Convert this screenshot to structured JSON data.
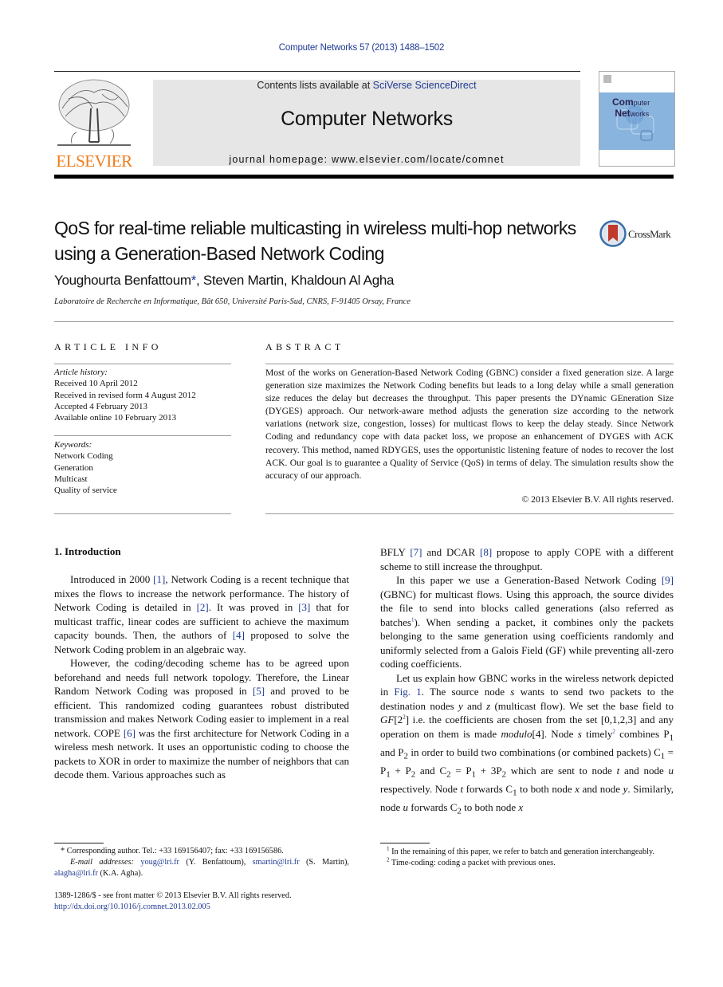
{
  "citation": "Computer Networks 57 (2013) 1488–1502",
  "header": {
    "contents_prefix": "Contents lists available at ",
    "contents_link": "SciVerse ScienceDirect",
    "journal_title": "Computer Networks",
    "homepage": "journal homepage: www.elsevier.com/locate/comnet",
    "publisher_logo_text": "ELSEVIER",
    "cover_title_line1_big": "Com",
    "cover_title_line1_small": "puter",
    "cover_title_line2_big": "Net",
    "cover_title_line2_small": "works",
    "brand_color": "#f07b1b",
    "link_color": "#1f3a93",
    "cover_color": "#88b4de"
  },
  "article": {
    "title": "QoS for real-time reliable multicasting in wireless multi-hop networks using a Generation-Based Network Coding",
    "crossmark_label": "CrossMark",
    "authors": "Youghourta Benfattoum",
    "authors_star": "*",
    "authors_rest": ", Steven Martin, Khaldoun Al Agha",
    "affiliation": "Laboratoire de Recherche en Informatique, Bât 650, Université Paris-Sud, CNRS, F-91405 Orsay, France"
  },
  "article_info": {
    "heading": "ARTICLE INFO",
    "history_label": "Article history:",
    "history": [
      "Received 10 April 2012",
      "Received in revised form 4 August 2012",
      "Accepted 4 February 2013",
      "Available online 10 February 2013"
    ],
    "keywords_label": "Keywords:",
    "keywords": [
      "Network Coding",
      "Generation",
      "Multicast",
      "Quality of service"
    ]
  },
  "abstract": {
    "heading": "ABSTRACT",
    "text": "Most of the works on Generation-Based Network Coding (GBNC) consider a fixed generation size. A large generation size maximizes the Network Coding benefits but leads to a long delay while a small generation size reduces the delay but decreases the throughput. This paper presents the DYnamic GEneration Size (DYGES) approach. Our network-aware method adjusts the generation size according to the network variations (network size, congestion, losses) for multicast flows to keep the delay steady. Since Network Coding and redundancy cope with data packet loss, we propose an enhancement of DYGES with ACK recovery. This method, named RDYGES, uses the opportunistic listening feature of nodes to recover the lost ACK. Our goal is to guarantee a Quality of Service (QoS) in terms of delay. The simulation results show the accuracy of our approach.",
    "copyright": "© 2013 Elsevier B.V. All rights reserved."
  },
  "body": {
    "section_heading": "1. Introduction",
    "left": {
      "p1": [
        "Introduced in 2000 ",
        "[1]",
        ", Network Coding is a recent technique that mixes the flows to increase the network performance. The history of Network Coding is detailed in ",
        "[2]",
        ". It was proved in ",
        "[3]",
        " that for multicast traffic, linear codes are sufficient to achieve the maximum capacity bounds. Then, the authors of ",
        "[4]",
        " proposed to solve the Network Coding problem in an algebraic way."
      ],
      "p2": [
        "However, the coding/decoding scheme has to be agreed upon beforehand and needs full network topology. Therefore, the Linear Random Network Coding was proposed in ",
        "[5]",
        " and proved to be efficient. This randomized coding guarantees robust distributed transmission and makes Network Coding easier to implement in a real network. COPE ",
        "[6]",
        " was the first architecture for Network Coding in a wireless mesh network. It uses an opportunistic coding to choose the packets to XOR in order to maximize the number of neighbors that can decode them. Various approaches such as"
      ]
    },
    "right": {
      "p0": [
        "BFLY ",
        "[7]",
        " and DCAR ",
        "[8]",
        " propose to apply COPE with a different scheme to still increase the throughput."
      ],
      "p1": [
        "In this paper we use a Generation-Based Network Coding ",
        "[9]",
        " (GBNC) for multicast flows. Using this approach, the source divides the file to send into blocks called generations (also referred as batches",
        "1",
        "). When sending a packet, it combines only the packets belonging to the same generation using coefficients randomly and uniformly selected from a Galois Field (GF) while preventing all-zero coding coefficients."
      ],
      "p2": [
        "Let us explain how GBNC works in the wireless network depicted in ",
        "Fig. 1",
        ". The source node ",
        "s",
        " wants to send two packets to the destination nodes ",
        "y",
        " and ",
        "z",
        " (multicast flow). We set the base field to ",
        "GF",
        "[2",
        "2",
        "] i.e. the coefficients are chosen from the set [0,1,2,3] and any operation on them is made ",
        "modulo",
        "[4]. Node ",
        "s",
        " timely",
        "2",
        " combines P",
        "1",
        " and P",
        "2",
        " in order to build two combinations (or combined packets) C",
        "1",
        " = P",
        "1",
        " + P",
        "2",
        " and C",
        "2",
        " = P",
        "1",
        " + 3P",
        "2",
        " which are sent to node ",
        "t",
        " and node ",
        "u",
        " respectively. Node ",
        "t",
        " forwards C",
        "1",
        " to both node ",
        "x",
        " and node ",
        "y",
        ". Similarly, node ",
        "u",
        " forwards C",
        "2",
        " to both node ",
        "x"
      ]
    }
  },
  "footnotes": {
    "left": {
      "corresponding": "* Corresponding author. Tel.: +33 169156407; fax: +33 169156586.",
      "email_label": "E-mail addresses:",
      "email1": "youg@lri.fr",
      "email1_name": " (Y. Benfattoum), ",
      "email2": "smartin@lri.fr",
      "email2_name": " (S. Martin), ",
      "email3": "alagha@lri.fr",
      "email3_name": " (K.A. Agha).",
      "issn": "1389-1286/$ - see front matter © 2013 Elsevier B.V. All rights reserved.",
      "doi": "http://dx.doi.org/10.1016/j.comnet.2013.02.005"
    },
    "right": [
      {
        "mark": "1",
        "text": "In the remaining of this paper, we refer to batch and generation interchangeably."
      },
      {
        "mark": "2",
        "text": "Time-coding: coding a packet with previous ones."
      }
    ]
  }
}
